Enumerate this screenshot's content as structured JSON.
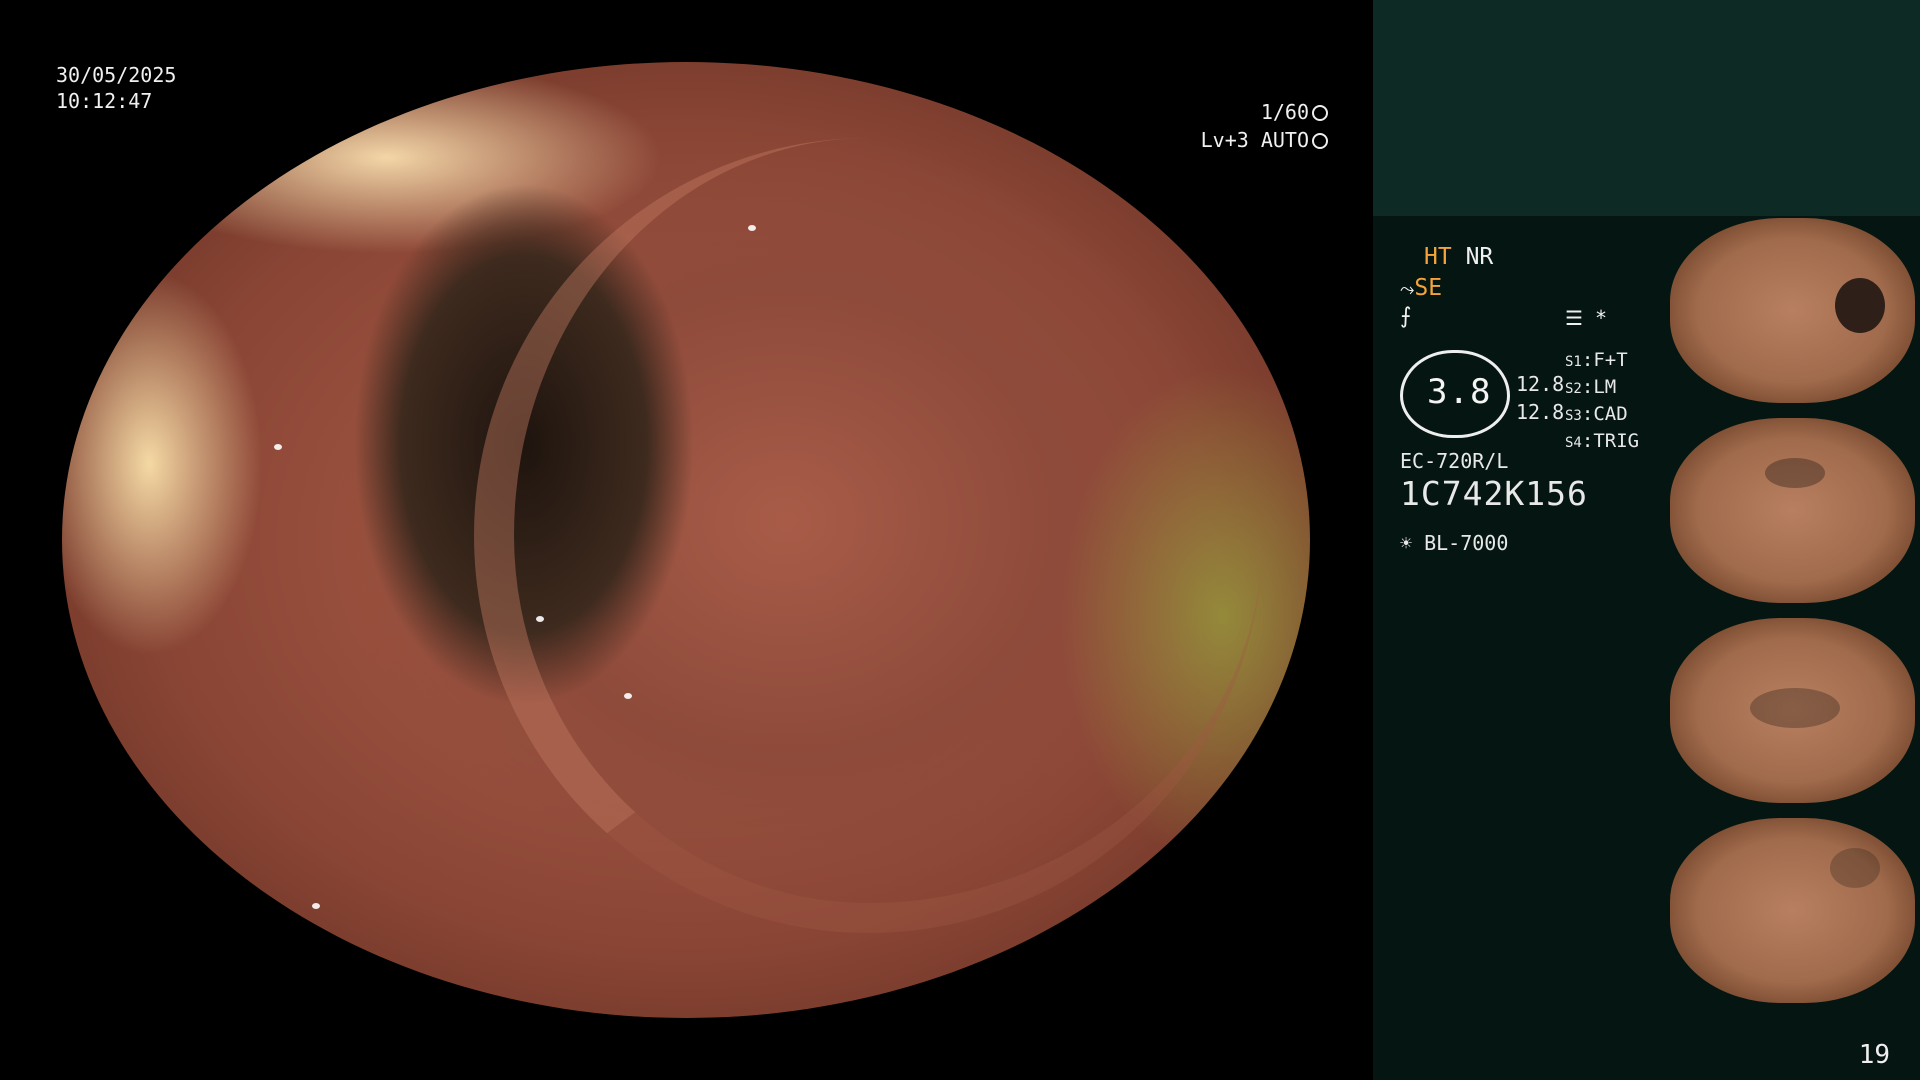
{
  "overlay": {
    "date": "30/05/2025",
    "time": "10:12:47",
    "shutter": "1/60",
    "level": "Lv+3",
    "mode": "AUTO"
  },
  "panel": {
    "ht": "HT",
    "nr": "NR",
    "se": "SE",
    "gauge_value": "3.8",
    "values": [
      "12.8",
      "12.8"
    ],
    "settings": [
      {
        "key": "S1",
        "value": "F+T"
      },
      {
        "key": "S2",
        "value": "LM"
      },
      {
        "key": "S3",
        "value": "CAD"
      },
      {
        "key": "S4",
        "value": "TRIG"
      }
    ],
    "asterisk": "*",
    "scope_model": "EC-720R/L",
    "serial": "1C742K156",
    "light_source": "BL-7000",
    "page_number": "19"
  },
  "colors": {
    "panel_bg": "#051612",
    "panel_top": "#0e2a24",
    "accent": "#f4a43a"
  }
}
